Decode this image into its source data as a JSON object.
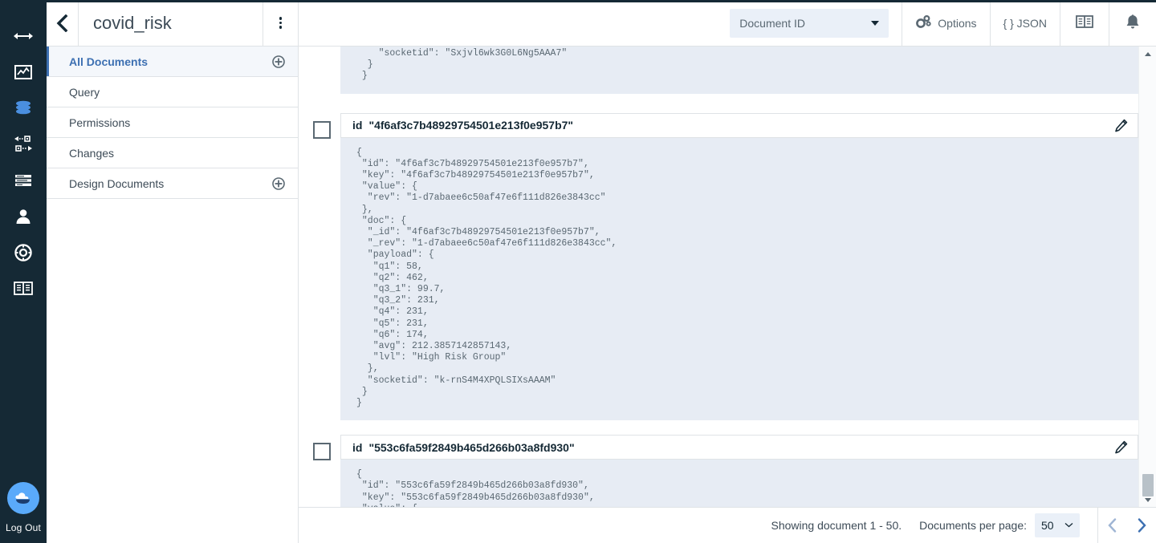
{
  "rail": {
    "icons": [
      {
        "name": "resize-arrows-icon",
        "label": "Toggle width"
      },
      {
        "name": "analytics-icon",
        "label": "Analytics"
      },
      {
        "name": "database-icon",
        "label": "Databases"
      },
      {
        "name": "replication-icon",
        "label": "Replication"
      },
      {
        "name": "activity-tasks-icon",
        "label": "Active Tasks"
      },
      {
        "name": "user-icon",
        "label": "Account"
      },
      {
        "name": "lifesaver-icon",
        "label": "Support"
      },
      {
        "name": "documentation-icon",
        "label": "Documentation"
      }
    ],
    "logo_name": "cloudant-cloud-logo",
    "logout_label": "Log Out"
  },
  "nav": {
    "back_icon": "back-chevron-icon",
    "database_title": "covid_risk",
    "overflow_icon": "kebab-menu-icon",
    "items": [
      {
        "label": "All Documents",
        "active": true,
        "has_add": true
      },
      {
        "label": "Query",
        "active": false,
        "has_add": false
      },
      {
        "label": "Permissions",
        "active": false,
        "has_add": false
      },
      {
        "label": "Changes",
        "active": false,
        "has_add": false
      },
      {
        "label": "Design Documents",
        "active": false,
        "has_add": true
      }
    ]
  },
  "toolbar": {
    "document_id_select": "Document ID",
    "options_label": "Options",
    "json_label": "{ } JSON",
    "docs_icon": "documentation-book-icon",
    "bell_icon": "notifications-bell-icon",
    "gear_icon": "options-gears-icon"
  },
  "documents": [
    {
      "partial_top": true,
      "json": "    \"socketid\": \"Sxjvl6wk3G0L6Ng5AAA7\"\n  }\n }"
    },
    {
      "id_label": "id",
      "id_value": "\"4f6af3c7b48929754501e213f0e957b7\"",
      "edit_icon": "edit-pencil-icon",
      "json": "{\n \"id\": \"4f6af3c7b48929754501e213f0e957b7\",\n \"key\": \"4f6af3c7b48929754501e213f0e957b7\",\n \"value\": {\n  \"rev\": \"1-d7abaee6c50af47e6f111d826e3843cc\"\n },\n \"doc\": {\n  \"_id\": \"4f6af3c7b48929754501e213f0e957b7\",\n  \"_rev\": \"1-d7abaee6c50af47e6f111d826e3843cc\",\n  \"payload\": {\n   \"q1\": 58,\n   \"q2\": 462,\n   \"q3_1\": 99.7,\n   \"q3_2\": 231,\n   \"q4\": 231,\n   \"q5\": 231,\n   \"q6\": 174,\n   \"avg\": 212.3857142857143,\n   \"lvl\": \"High Risk Group\"\n  },\n  \"socketid\": \"k-rnS4M4XPQLSIXsAAAM\"\n }\n}"
    },
    {
      "id_label": "id",
      "id_value": "\"553c6fa59f2849b465d266b03a8fd930\"",
      "edit_icon": "edit-pencil-icon",
      "json": "{\n \"id\": \"553c6fa59f2849b465d266b03a8fd930\",\n \"key\": \"553c6fa59f2849b465d266b03a8fd930\",\n \"value\": {"
    }
  ],
  "footer": {
    "showing_text": "Showing document 1 - 50.",
    "per_page_label": "Documents per page:",
    "per_page_value": "50",
    "prev_icon": "chevron-left-icon",
    "next_icon": "chevron-right-icon"
  },
  "colors": {
    "rail_bg": "#152935",
    "accent_blue": "#3d70b2",
    "json_bg": "#e7ecf4",
    "select_bg": "#eaf0f8",
    "border": "#dfe3e6"
  }
}
